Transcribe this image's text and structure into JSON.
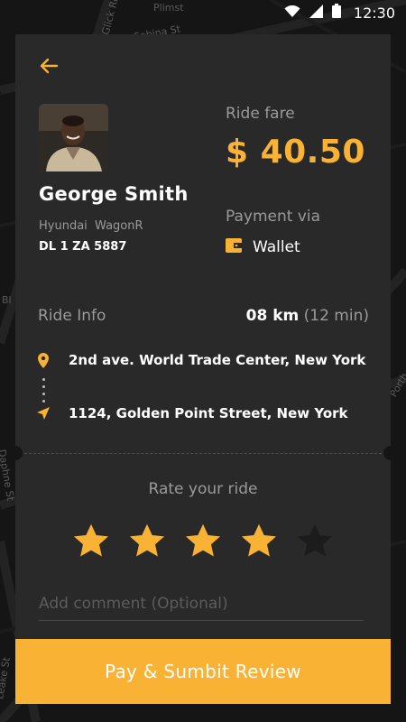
{
  "status_bar": {
    "time": "12:30"
  },
  "map": {
    "labels": [
      "Plimst",
      "Glick Rd",
      "Sabina St",
      "Daphne St",
      "Leake St",
      "Bl",
      "Porth"
    ]
  },
  "fare": {
    "label": "Ride fare",
    "value": "$ 40.50"
  },
  "payment": {
    "label": "Payment via",
    "method": "Wallet"
  },
  "driver": {
    "name": "George Smith",
    "car_model": "Hyundai  WagonR",
    "plate": "DL 1  ZA 5887"
  },
  "ride_info": {
    "label": "Ride Info",
    "distance": "08 km",
    "duration": "(12 min)",
    "pickup": "2nd ave. World Trade Center, New York",
    "dropoff": "1124, Golden Point Street, New York"
  },
  "rating": {
    "label": "Rate your ride",
    "value": 4,
    "max": 5
  },
  "comment": {
    "placeholder": "Add comment (Optional)",
    "value": ""
  },
  "submit": {
    "label": "Pay & Sumbit Review"
  },
  "colors": {
    "accent": "#f9b233",
    "card": "#292929",
    "muted": "#9a9a9a"
  },
  "icons": [
    "back-arrow-icon",
    "wallet-icon",
    "location-pin-icon",
    "navigation-icon",
    "star-icon",
    "wifi-icon",
    "signal-icon",
    "battery-icon"
  ]
}
